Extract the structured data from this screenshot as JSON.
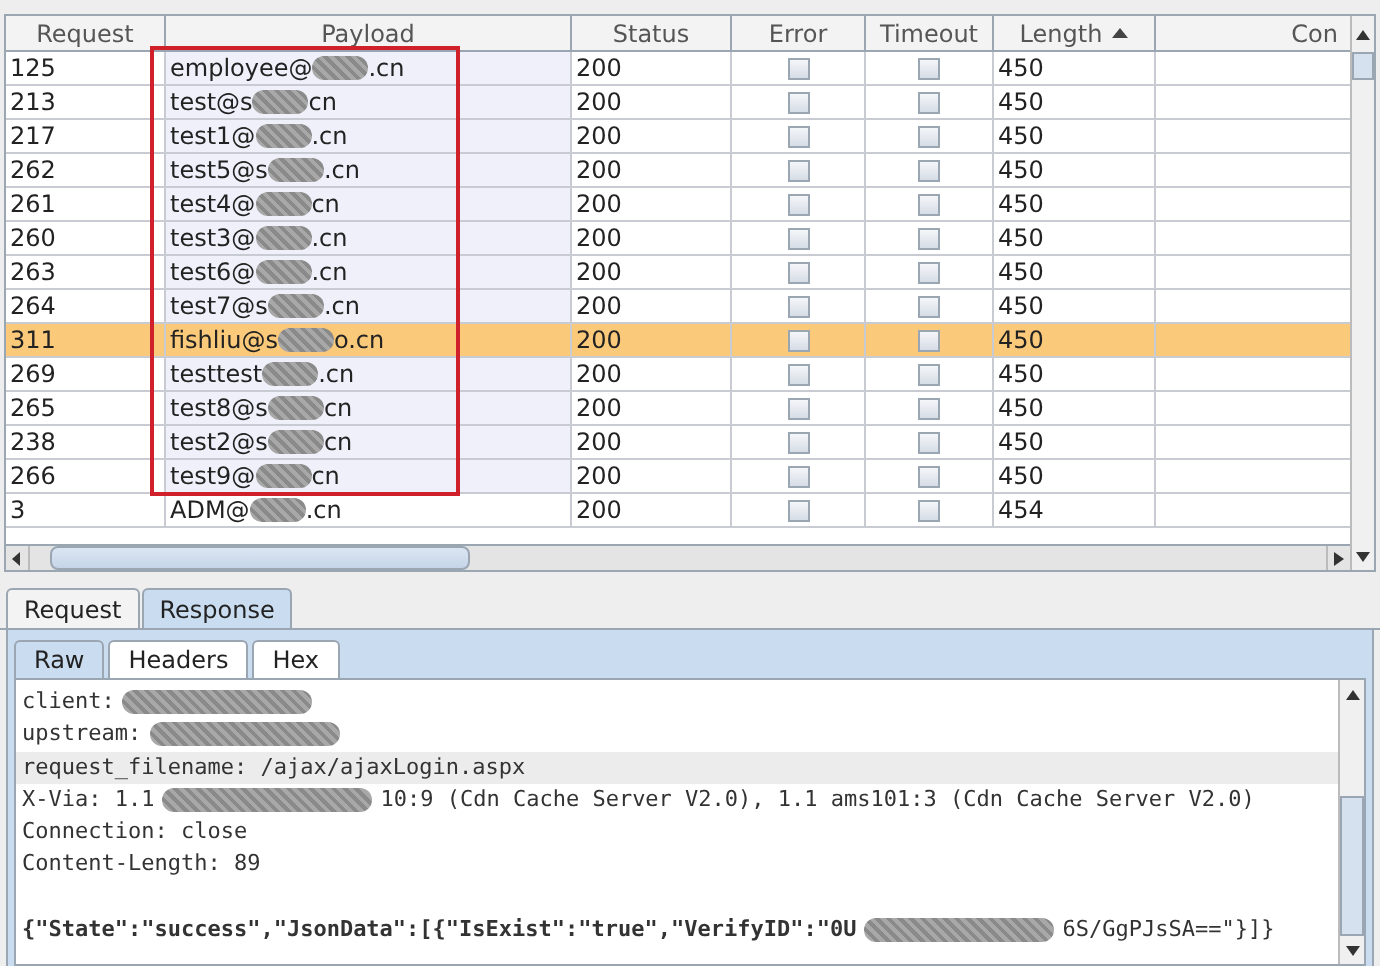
{
  "results_table": {
    "columns": [
      {
        "label": "Request",
        "sorted": false
      },
      {
        "label": "Payload",
        "sorted": false
      },
      {
        "label": "Status",
        "sorted": false
      },
      {
        "label": "Error",
        "sorted": false
      },
      {
        "label": "Timeout",
        "sorted": false
      },
      {
        "label": "Length",
        "sorted": true
      },
      {
        "label": "Con",
        "sorted": false
      }
    ],
    "rows": [
      {
        "request": "125",
        "payload": [
          {
            "kind": "text",
            "text": "employee@"
          },
          {
            "kind": "redaction"
          },
          {
            "kind": "text",
            "text": ".cn"
          }
        ],
        "status": "200",
        "error": false,
        "timeout": false,
        "length": "450",
        "selected": false,
        "boxed": true
      },
      {
        "request": "213",
        "payload": [
          {
            "kind": "text",
            "text": "test@s"
          },
          {
            "kind": "redaction"
          },
          {
            "kind": "text",
            "text": "cn"
          }
        ],
        "status": "200",
        "error": false,
        "timeout": false,
        "length": "450",
        "selected": false,
        "boxed": true
      },
      {
        "request": "217",
        "payload": [
          {
            "kind": "text",
            "text": "test1@"
          },
          {
            "kind": "redaction"
          },
          {
            "kind": "text",
            "text": ".cn"
          }
        ],
        "status": "200",
        "error": false,
        "timeout": false,
        "length": "450",
        "selected": false,
        "boxed": true
      },
      {
        "request": "262",
        "payload": [
          {
            "kind": "text",
            "text": "test5@s"
          },
          {
            "kind": "redaction"
          },
          {
            "kind": "text",
            "text": ".cn"
          }
        ],
        "status": "200",
        "error": false,
        "timeout": false,
        "length": "450",
        "selected": false,
        "boxed": true
      },
      {
        "request": "261",
        "payload": [
          {
            "kind": "text",
            "text": "test4@"
          },
          {
            "kind": "redaction"
          },
          {
            "kind": "text",
            "text": "cn"
          }
        ],
        "status": "200",
        "error": false,
        "timeout": false,
        "length": "450",
        "selected": false,
        "boxed": true
      },
      {
        "request": "260",
        "payload": [
          {
            "kind": "text",
            "text": "test3@"
          },
          {
            "kind": "redaction"
          },
          {
            "kind": "text",
            "text": ".cn"
          }
        ],
        "status": "200",
        "error": false,
        "timeout": false,
        "length": "450",
        "selected": false,
        "boxed": true
      },
      {
        "request": "263",
        "payload": [
          {
            "kind": "text",
            "text": "test6@"
          },
          {
            "kind": "redaction"
          },
          {
            "kind": "text",
            "text": ".cn"
          }
        ],
        "status": "200",
        "error": false,
        "timeout": false,
        "length": "450",
        "selected": false,
        "boxed": true
      },
      {
        "request": "264",
        "payload": [
          {
            "kind": "text",
            "text": "test7@s"
          },
          {
            "kind": "redaction"
          },
          {
            "kind": "text",
            "text": ".cn"
          }
        ],
        "status": "200",
        "error": false,
        "timeout": false,
        "length": "450",
        "selected": false,
        "boxed": true
      },
      {
        "request": "311",
        "payload": [
          {
            "kind": "text",
            "text": "fishliu@s"
          },
          {
            "kind": "redaction"
          },
          {
            "kind": "text",
            "text": "o.cn"
          }
        ],
        "status": "200",
        "error": false,
        "timeout": false,
        "length": "450",
        "selected": true,
        "boxed": true
      },
      {
        "request": "269",
        "payload": [
          {
            "kind": "text",
            "text": "testtest"
          },
          {
            "kind": "redaction"
          },
          {
            "kind": "text",
            "text": ".cn"
          }
        ],
        "status": "200",
        "error": false,
        "timeout": false,
        "length": "450",
        "selected": false,
        "boxed": true
      },
      {
        "request": "265",
        "payload": [
          {
            "kind": "text",
            "text": "test8@s"
          },
          {
            "kind": "redaction"
          },
          {
            "kind": "text",
            "text": "cn"
          }
        ],
        "status": "200",
        "error": false,
        "timeout": false,
        "length": "450",
        "selected": false,
        "boxed": true
      },
      {
        "request": "238",
        "payload": [
          {
            "kind": "text",
            "text": "test2@s"
          },
          {
            "kind": "redaction"
          },
          {
            "kind": "text",
            "text": "cn"
          }
        ],
        "status": "200",
        "error": false,
        "timeout": false,
        "length": "450",
        "selected": false,
        "boxed": true
      },
      {
        "request": "266",
        "payload": [
          {
            "kind": "text",
            "text": "test9@"
          },
          {
            "kind": "redaction"
          },
          {
            "kind": "text",
            "text": "cn"
          }
        ],
        "status": "200",
        "error": false,
        "timeout": false,
        "length": "450",
        "selected": false,
        "boxed": true
      },
      {
        "request": "3",
        "payload": [
          {
            "kind": "text",
            "text": "ADM@"
          },
          {
            "kind": "redaction"
          },
          {
            "kind": "text",
            "text": ".cn"
          }
        ],
        "status": "200",
        "error": false,
        "timeout": false,
        "length": "454",
        "selected": false,
        "boxed": false
      }
    ]
  },
  "message_tabs": [
    {
      "label": "Request",
      "selected": false
    },
    {
      "label": "Response",
      "selected": true
    }
  ],
  "view_tabs": [
    {
      "label": "Raw",
      "selected": true
    },
    {
      "label": "Headers",
      "selected": false
    },
    {
      "label": "Hex",
      "selected": false
    }
  ],
  "response_lines": [
    {
      "highlighted": false,
      "segments": [
        {
          "kind": "text",
          "text": "client:"
        },
        {
          "kind": "redaction"
        }
      ]
    },
    {
      "highlighted": false,
      "segments": [
        {
          "kind": "text",
          "text": "upstream:"
        },
        {
          "kind": "redaction"
        }
      ]
    },
    {
      "highlighted": true,
      "segments": [
        {
          "kind": "text",
          "text": "request_filename: /ajax/ajaxLogin.aspx"
        }
      ]
    },
    {
      "highlighted": false,
      "segments": [
        {
          "kind": "text",
          "text": "X-Via: 1.1"
        },
        {
          "kind": "redaction"
        },
        {
          "kind": "text",
          "text": "10:9 (Cdn Cache Server V2.0), 1.1 ams101:3 (Cdn Cache Server V2.0)"
        }
      ]
    },
    {
      "highlighted": false,
      "segments": [
        {
          "kind": "text",
          "text": "Connection: close"
        }
      ]
    },
    {
      "highlighted": false,
      "segments": [
        {
          "kind": "text",
          "text": "Content-Length: 89"
        }
      ]
    },
    {
      "highlighted": false
    },
    {
      "highlighted": false,
      "segments": [
        {
          "kind": "text",
          "text": "{\"State\":\"success\",\"JsonData\":[{\"IsExist\":\"true\",\"VerifyID\":\"0U"
        },
        {
          "kind": "redaction"
        },
        {
          "kind": "text",
          "text": "6S/GgPJsSA==\"}]}"
        }
      ]
    }
  ]
}
